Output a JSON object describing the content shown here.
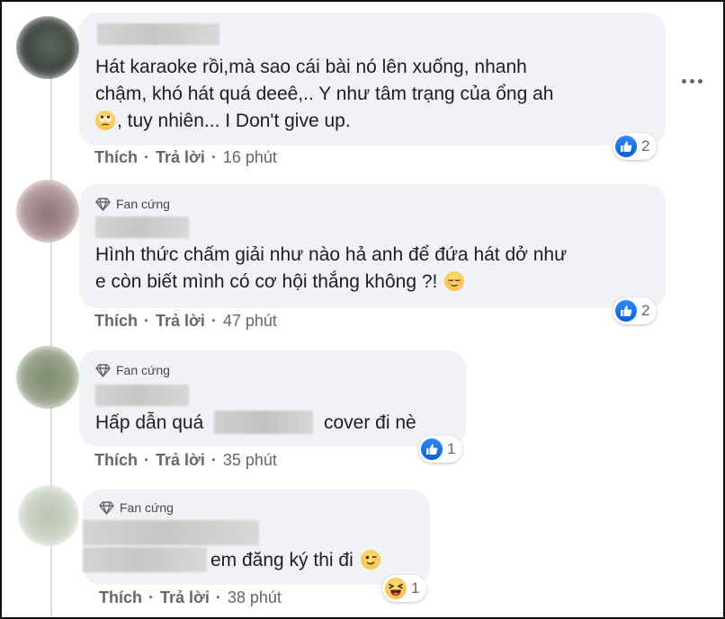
{
  "comments": [
    {
      "badge": "",
      "text_lines": [
        "Hát karaoke rồi,mà sao cái bài nó lên xuống, nhanh",
        "chậm, khó hát quá deeê,.. Y như tâm trạng của ổng ah",
        ", tuy nhiên... I Don't give up."
      ],
      "emoji": "rolling-eyes-emoji",
      "reaction": {
        "icon": "like-icon",
        "count": "2"
      },
      "like_label": "Thích",
      "reply_label": "Trả lời",
      "time": "16 phút"
    },
    {
      "badge": "Fan cứng",
      "text_lines": [
        "Hình thức chấm giải như nào hả anh để đứa hát dở như",
        "e còn biết mình có cơ hội thắng không ?!"
      ],
      "emoji": "relieved-emoji",
      "reaction": {
        "icon": "like-icon",
        "count": "2"
      },
      "like_label": "Thích",
      "reply_label": "Trả lời",
      "time": "47 phút"
    },
    {
      "badge": "Fan cứng",
      "text_before": "Hấp dẫn quá",
      "text_after": "cover đi nè",
      "reaction": {
        "icon": "like-icon",
        "count": "1"
      },
      "like_label": "Thích",
      "reply_label": "Trả lời",
      "time": "35 phút"
    },
    {
      "badge": "Fan cứng",
      "text_after": "em đăng ký thi đi",
      "emoji": "winking-emoji",
      "reaction": {
        "icon": "laughing-emoji",
        "count": "1"
      },
      "like_label": "Thích",
      "reply_label": "Trả lời",
      "time": "38 phút"
    }
  ],
  "colors": {
    "bubble": "#f0f2f5",
    "like_blue": "#1877f2",
    "meta_gray": "#65676b"
  }
}
